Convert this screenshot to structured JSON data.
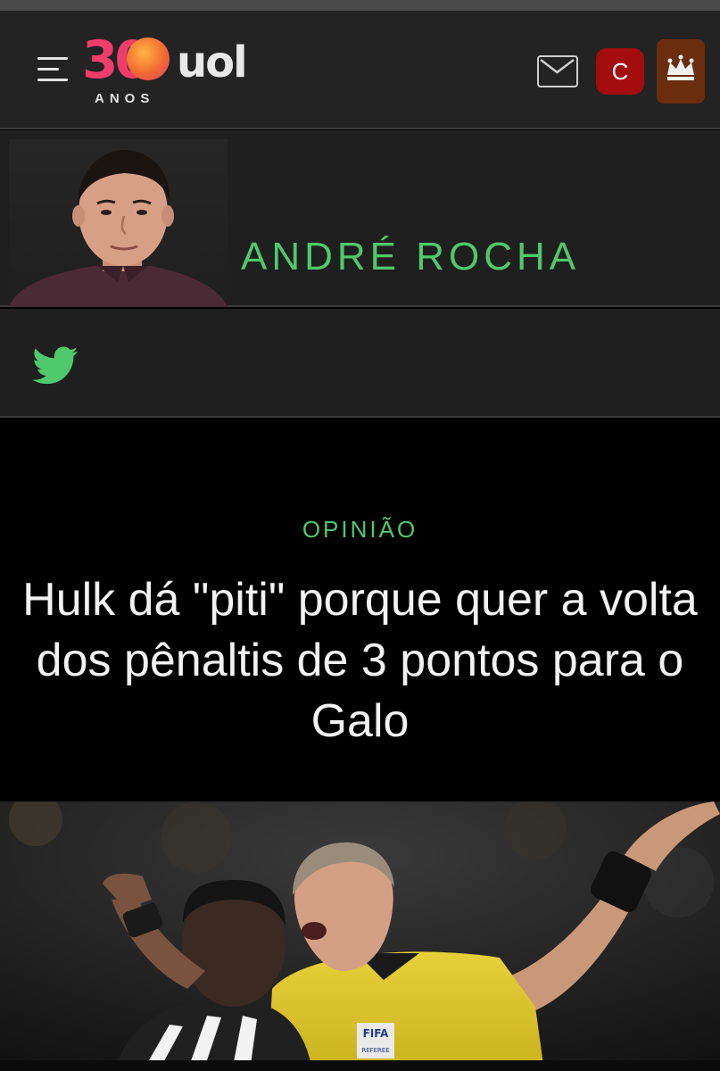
{
  "header": {
    "logo": {
      "number": "30",
      "brand": "uol",
      "subtitle": "ANOS"
    },
    "menu_icon": "hamburger-menu-icon",
    "mail_icon": "envelope-icon",
    "user_badge_letter": "C",
    "crown_icon": "crown-icon",
    "colors": {
      "bar": "#232323",
      "badge": "#a40d0d",
      "crown_bg": "#6a2e0f"
    }
  },
  "author": {
    "name": "ANDRÉ ROCHA",
    "accent_color": "#4fc96b"
  },
  "social": {
    "icon": "twitter-icon"
  },
  "article": {
    "kicker": "OPINIÃO",
    "headline": "Hulk dá \"piti\" porque quer a volta dos pênaltis de 3 pontos para o Galo",
    "photo_badge": "FIFA",
    "photo_badge_sub": "REFEREE"
  }
}
